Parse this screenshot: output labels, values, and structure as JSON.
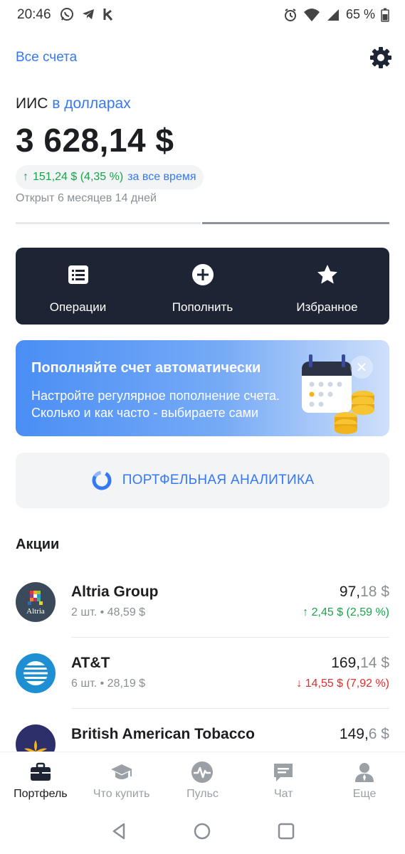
{
  "status_bar": {
    "time": "20:46",
    "battery": "65 %",
    "left_icons": [
      "whatsapp-icon",
      "telegram-icon",
      "k-app-icon"
    ],
    "right_icons": [
      "alarm-icon",
      "wifi-icon",
      "signal-icon",
      "battery-icon"
    ]
  },
  "header": {
    "all_accounts": "Все счета",
    "settings_icon": "gear-icon"
  },
  "account": {
    "name": "ИИС",
    "currency": "в долларах",
    "balance": "3 628,14 $",
    "yield_arrow": "↑",
    "yield_value": "151,24 $ (4,35 %)",
    "yield_period": "за все время",
    "opened": "Открыт 6 месяцев 14 дней"
  },
  "actions": [
    {
      "label": "Операции",
      "icon": "list-icon"
    },
    {
      "label": "Пополнить",
      "icon": "plus-circle-icon"
    },
    {
      "label": "Избранное",
      "icon": "star-icon"
    }
  ],
  "banner": {
    "title": "Пополняйте счет автоматически",
    "text_line1": "Настройте регулярное пополнение счета.",
    "text_line2": "Сколько и как часто - выбираете сами",
    "close": "✕"
  },
  "analytics": {
    "label": "ПОРТФЕЛЬНАЯ АНАЛИТИКА",
    "icon": "donut-chart-icon"
  },
  "stocks_section": {
    "title": "Акции",
    "items": [
      {
        "name": "Altria Group",
        "qty": "2 шт. • 48,59 $",
        "price_main": "97,",
        "price_cents": "18 $",
        "change": "↑ 2,45 $ (2,59 %)",
        "direction": "up",
        "logo_text": "Altria"
      },
      {
        "name": "AT&T",
        "qty": "6 шт. • 28,19 $",
        "price_main": "169,",
        "price_cents": "14 $",
        "change": "↓ 14,55 $ (7,92 %)",
        "direction": "down",
        "logo_text": ""
      },
      {
        "name": "British American Tobacco",
        "qty": "",
        "price_main": "149,",
        "price_cents": "6 $",
        "change": "",
        "direction": "down",
        "logo_text": ""
      }
    ]
  },
  "bottom_nav": [
    {
      "label": "Портфель",
      "icon": "briefcase-icon",
      "active": true
    },
    {
      "label": "Что купить",
      "icon": "graduation-cap-icon",
      "active": false
    },
    {
      "label": "Пульс",
      "icon": "pulse-icon",
      "active": false
    },
    {
      "label": "Чат",
      "icon": "chat-icon",
      "active": false
    },
    {
      "label": "Еще",
      "icon": "user-icon",
      "active": false
    }
  ],
  "colors": {
    "accent": "#3478f6",
    "dark_panel": "#1d2433",
    "positive": "#19a44a",
    "negative": "#e02d2d",
    "muted": "#8a8f95"
  }
}
